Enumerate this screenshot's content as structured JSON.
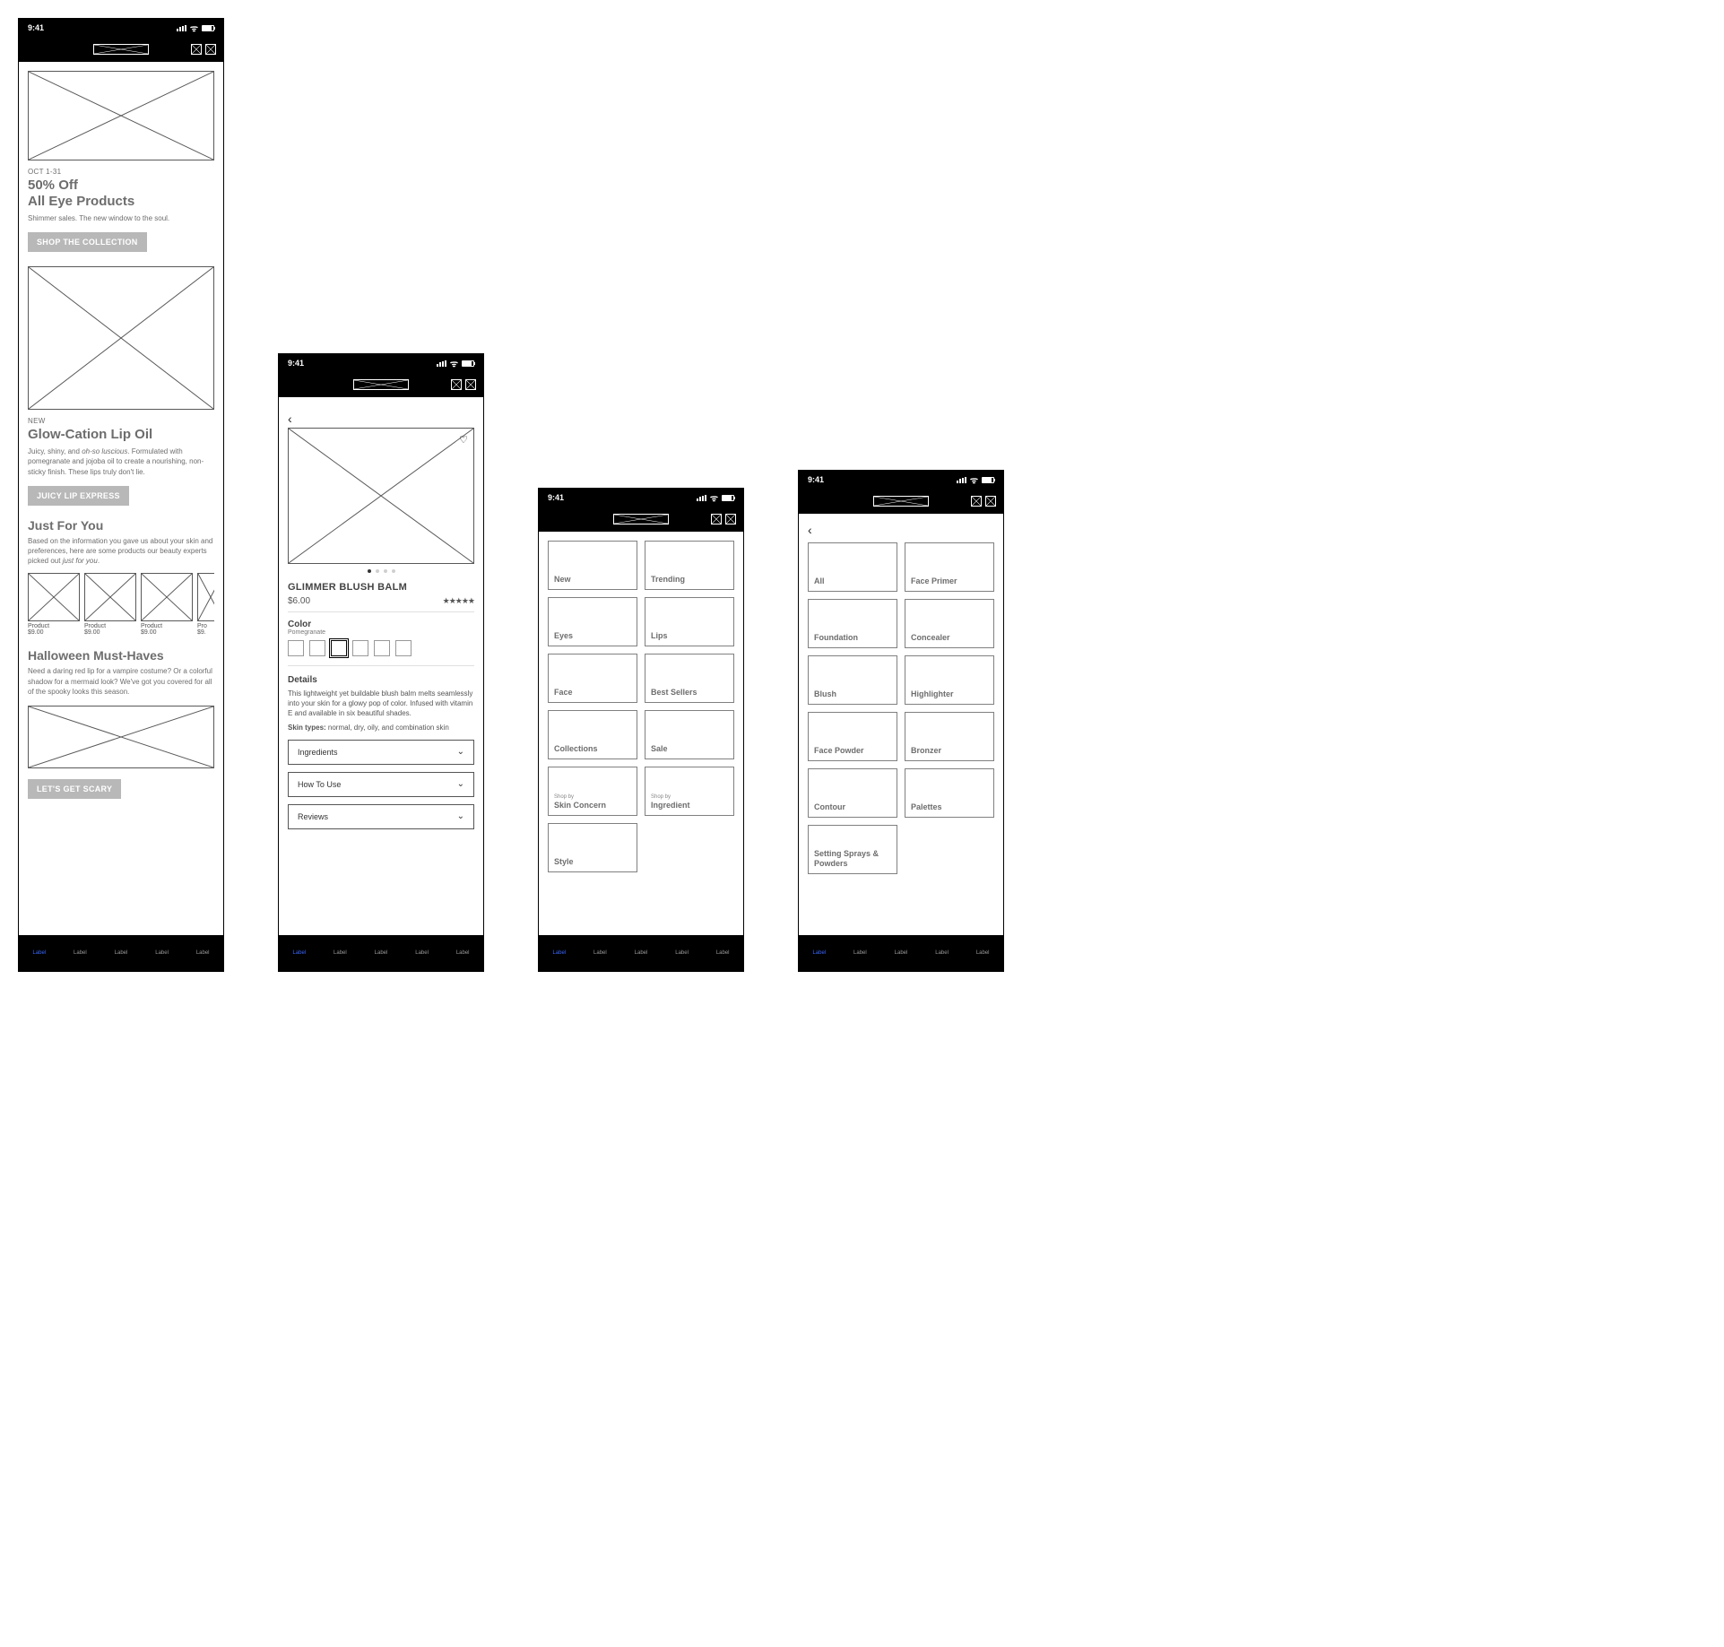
{
  "status": {
    "time": "9:41"
  },
  "tabbar": [
    "Label",
    "Label",
    "Label",
    "Label",
    "Label"
  ],
  "home": {
    "promo1": {
      "eyebrow": "OCT 1-31",
      "title1": "50% Off",
      "title2": "All Eye Products",
      "body": "Shimmer sales. The new window to the soul.",
      "cta": "SHOP THE COLLECTION"
    },
    "promo2": {
      "eyebrow": "NEW",
      "title": "Glow-Cation Lip Oil",
      "body": "Juicy, shiny, and <em>oh-so luscious</em>. Formulated with pomegranate and jojoba oil to create a nourishing, non-sticky finish. These lips truly don't lie.",
      "cta": "JUICY LIP EXPRESS"
    },
    "jfy": {
      "title": "Just For You",
      "body": "Based on the information you gave us about your skin and preferences, here are some products our beauty experts picked out <em>just for you</em>.",
      "products": [
        {
          "name": "Product",
          "price": "$9.00"
        },
        {
          "name": "Product",
          "price": "$9.00"
        },
        {
          "name": "Product",
          "price": "$9.00"
        },
        {
          "name": "Pro",
          "price": "$9."
        }
      ]
    },
    "halloween": {
      "title": "Halloween Must-Haves",
      "body": "Need a daring red lip for a vampire costume? Or a colorful shadow for a mermaid look? We've got you covered for all of the spooky looks this season.",
      "cta": "LET'S GET SCARY"
    }
  },
  "pdp": {
    "title": "GLIMMER BLUSH BALM",
    "price": "$6.00",
    "stars": "★★★★★",
    "color_label": "Color",
    "color_value": "Pomegranate",
    "swatch_count": 6,
    "swatch_selected_index": 2,
    "details_heading": "Details",
    "details_body": "This lightweight yet buildable blush balm melts seamlessly into your skin for a glowy pop of color. Infused with vitamin E and available in six beautiful shades.",
    "skin_prefix": "Skin types:",
    "skin_body": " normal, dry, oily, and combination skin",
    "accordions": [
      "Ingredients",
      "How To Use",
      "Reviews"
    ]
  },
  "categories1": [
    {
      "label": "New"
    },
    {
      "label": "Trending"
    },
    {
      "label": "Eyes"
    },
    {
      "label": "Lips"
    },
    {
      "label": "Face"
    },
    {
      "label": "Best Sellers"
    },
    {
      "label": "Collections"
    },
    {
      "label": "Sale"
    },
    {
      "pre": "Shop by",
      "label": "Skin Concern"
    },
    {
      "pre": "Shop by",
      "label": "Ingredient"
    },
    {
      "label": "Style"
    }
  ],
  "categories2": [
    {
      "label": "All"
    },
    {
      "label": "Face Primer"
    },
    {
      "label": "Foundation"
    },
    {
      "label": "Concealer"
    },
    {
      "label": "Blush"
    },
    {
      "label": "Highlighter"
    },
    {
      "label": "Face Powder"
    },
    {
      "label": "Bronzer"
    },
    {
      "label": "Contour"
    },
    {
      "label": "Palettes"
    },
    {
      "label": "Setting Sprays & Powders"
    }
  ]
}
